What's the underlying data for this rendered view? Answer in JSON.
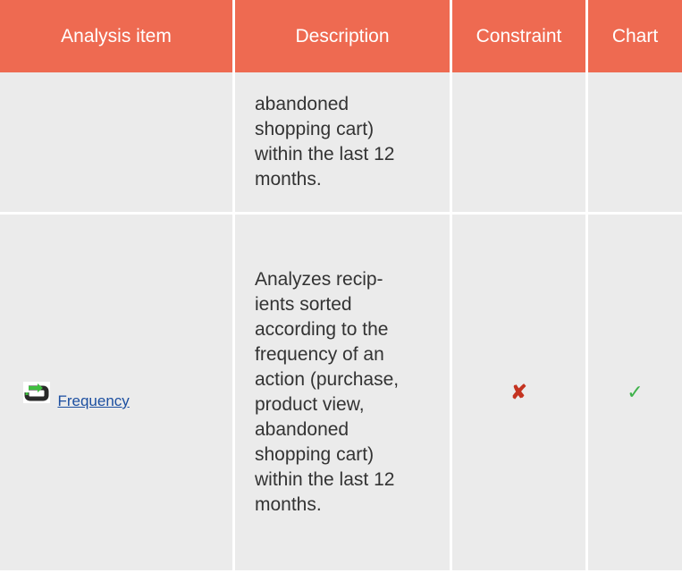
{
  "table": {
    "headers": [
      "Analysis item",
      "Description",
      "Constraint",
      "Chart"
    ],
    "rows": [
      {
        "item": "",
        "description_lines": [
          "abandoned",
          "shopping cart)",
          "within the last 12",
          "months."
        ],
        "constraint": "",
        "chart": ""
      },
      {
        "item": "Frequency",
        "icon": "repeat-icon",
        "description_lines": [
          "Analyzes recip-",
          "ients sorted",
          "according to the",
          "frequency of an",
          "action (purchase,",
          "product view,",
          "abandoned",
          "shopping cart)",
          "within the last 12",
          "months."
        ],
        "constraint": "✘",
        "chart": "✓"
      }
    ]
  },
  "colors": {
    "header_bg": "#ee6a51",
    "cell_bg": "#ebebeb",
    "link": "#1c4fa0",
    "cross": "#c43320",
    "check": "#3fb24b",
    "icon_green": "#3fbf3f"
  }
}
